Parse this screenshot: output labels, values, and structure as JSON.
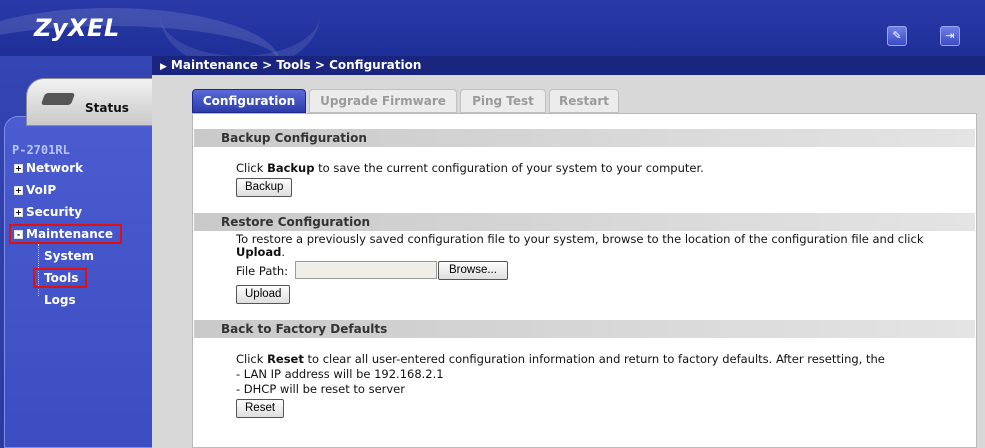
{
  "header": {
    "logo": "ZyXEL",
    "wizard_icon": "wizard-icon",
    "logout_icon": "logout-icon"
  },
  "sidebar": {
    "status_label": "Status",
    "model": "P-2701RL",
    "items": [
      {
        "label": "Network",
        "expander": "+"
      },
      {
        "label": "VoIP",
        "expander": "+"
      },
      {
        "label": "Security",
        "expander": "+"
      },
      {
        "label": "Maintenance",
        "expander": "-"
      }
    ],
    "subitems": [
      {
        "label": "System"
      },
      {
        "label": "Tools"
      },
      {
        "label": "Logs"
      }
    ]
  },
  "breadcrumb": "Maintenance > Tools > Configuration",
  "tabs": [
    {
      "label": "Configuration",
      "active": true
    },
    {
      "label": "Upgrade Firmware",
      "active": false
    },
    {
      "label": "Ping Test",
      "active": false
    },
    {
      "label": "Restart",
      "active": false
    }
  ],
  "backup": {
    "title": "Backup Configuration",
    "text_pre": "Click ",
    "text_bold": "Backup",
    "text_post": " to save the current configuration of your system to your computer.",
    "button": "Backup"
  },
  "restore": {
    "title": "Restore Configuration",
    "text_line1": "To restore a previously saved configuration file to your system, browse to the location of the configuration file and click",
    "text_bold": "Upload",
    "text_end": ".",
    "file_path_label": "File Path:",
    "file_path_value": "",
    "browse_button": "Browse...",
    "upload_button": "Upload"
  },
  "factory": {
    "title": "Back to Factory Defaults",
    "text_pre": "Click ",
    "text_bold": "Reset",
    "text_post": " to clear all user-entered configuration information and return to factory defaults. After resetting, the",
    "line2": "- LAN IP address will be 192.168.2.1",
    "line3": "- DHCP will be reset to server",
    "button": "Reset"
  },
  "colors": {
    "header_blue": "#1f2f98",
    "tab_active": "#2c3ca8",
    "highlight_red": "#e01010"
  }
}
